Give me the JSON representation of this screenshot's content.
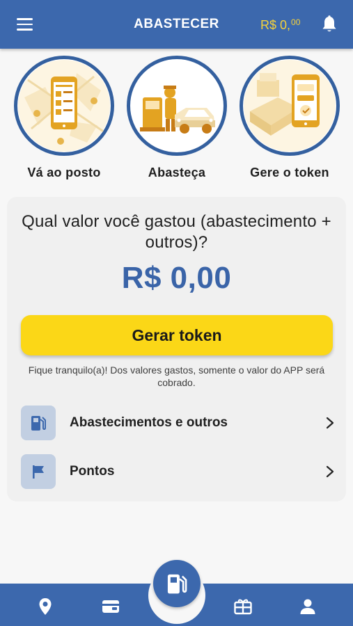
{
  "header": {
    "title": "ABASTECER",
    "balance_main": "R$ 0,",
    "balance_cents": "00",
    "menu_icon": "hamburger-icon",
    "bell_icon": "bell-icon"
  },
  "steps": [
    {
      "label": "Vá ao posto",
      "icon": "phone-map-illustration"
    },
    {
      "label": "Abasteça",
      "icon": "fueling-car-illustration"
    },
    {
      "label": "Gere o token",
      "icon": "token-phone-illustration"
    }
  ],
  "card": {
    "question": "Qual valor você gastou (abastecimento + outros)?",
    "amount": "R$ 0,00",
    "button_label": "Gerar token",
    "note": "Fique tranquilo(a)! Dos valores gastos, somente o valor do APP será cobrado.",
    "rows": [
      {
        "label": "Abastecimentos e outros",
        "icon": "fuel-pump-icon"
      },
      {
        "label": "Pontos",
        "icon": "flag-icon"
      }
    ]
  },
  "bottom_nav": {
    "items": [
      "location-pin-icon",
      "wallet-icon",
      "fuel-pump-icon",
      "gift-card-icon",
      "user-icon"
    ]
  },
  "colors": {
    "primary": "#3c68ad",
    "accent_yellow": "#fbd717",
    "balance_yellow": "#f6d23a",
    "amount_blue": "#3a64a8"
  }
}
